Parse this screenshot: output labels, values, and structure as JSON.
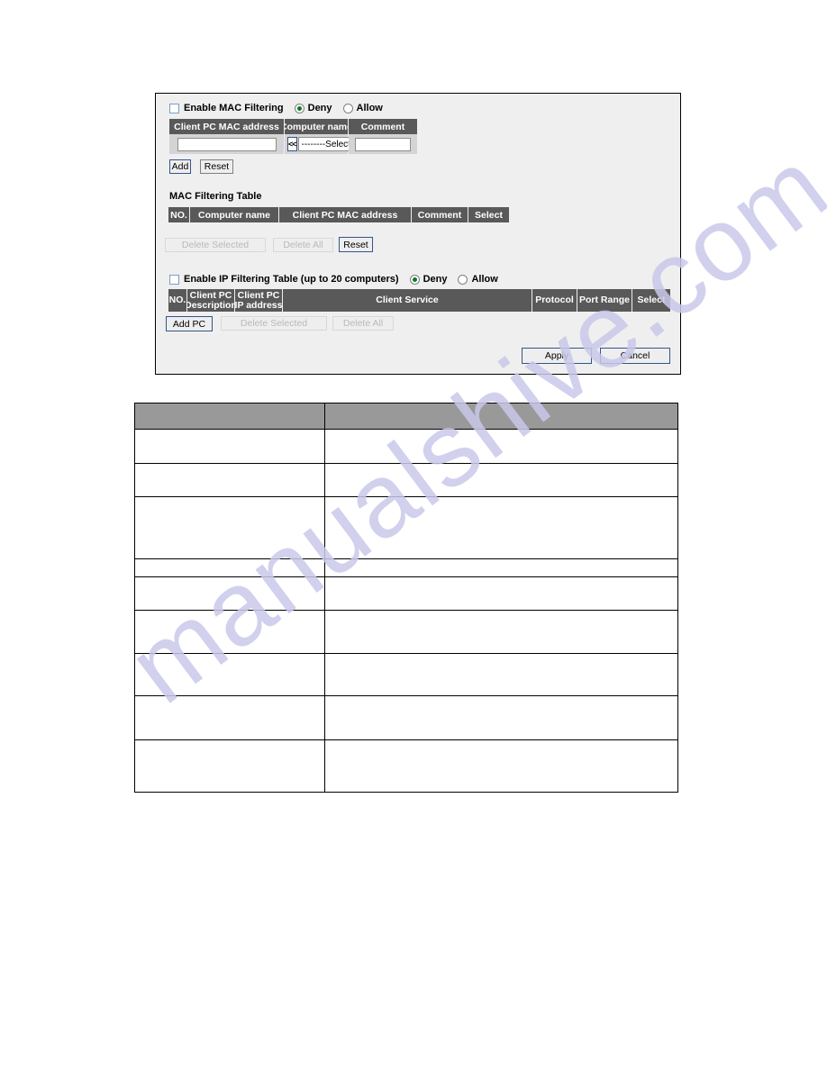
{
  "watermark": {
    "text": "manualshive.com"
  },
  "panel": {
    "mac_filtering": {
      "enable_label": "Enable MAC Filtering",
      "enable_checked": false,
      "deny_label": "Deny",
      "allow_label": "Allow",
      "mode_selected": "Deny",
      "columns": [
        "Client PC MAC address",
        "Computer name",
        "Comment"
      ],
      "mac_input_value": "",
      "select_value": "--------Select--------",
      "comment_input_value": "",
      "lt_button_label": "<<",
      "add_label": "Add",
      "reset_label": "Reset"
    },
    "mac_table": {
      "title": "MAC Filtering Table",
      "columns": [
        "NO.",
        "Computer name",
        "Client PC MAC address",
        "Comment",
        "Select"
      ],
      "rows": [],
      "delete_selected_label": "Delete Selected",
      "delete_all_label": "Delete All",
      "reset_label": "Reset"
    },
    "ip_filtering": {
      "enable_label": "Enable IP Filtering Table (up to 20 computers)",
      "enable_checked": false,
      "deny_label": "Deny",
      "allow_label": "Allow",
      "mode_selected": "Deny",
      "columns": [
        "NO.",
        "Client PC Description",
        "Client PC IP address",
        "Client Service",
        "Protocol",
        "Port Range",
        "Select"
      ],
      "col_no": "NO.",
      "col_desc_line1": "Client PC",
      "col_desc_line2": "Description",
      "col_ip_line1": "Client PC",
      "col_ip_line2": "IP address",
      "col_service": "Client Service",
      "col_protocol": "Protocol",
      "col_portrange": "Port Range",
      "col_select": "Select",
      "rows": [],
      "add_pc_label": "Add PC",
      "delete_selected_label": "Delete Selected",
      "delete_all_label": "Delete All"
    },
    "footer": {
      "apply_label": "Apply",
      "cancel_label": "Cancel"
    }
  },
  "desc_table": {
    "headers": [
      "",
      ""
    ],
    "rows": [
      {
        "label": "",
        "value": "",
        "height": 38
      },
      {
        "label": "",
        "value": "",
        "height": 37
      },
      {
        "label": "",
        "value": "",
        "height": 69
      },
      {
        "label": "",
        "value": "",
        "height": 20
      },
      {
        "label": "",
        "value": "",
        "height": 37
      },
      {
        "label": "",
        "value": "",
        "height": 48
      },
      {
        "label": "",
        "value": "",
        "height": 47
      },
      {
        "label": "",
        "value": "",
        "height": 49
      },
      {
        "label": "",
        "value": "",
        "height": 58
      }
    ]
  },
  "colors": {
    "panel_bg": "#efefef",
    "header_dark": "#595959",
    "header_light": "#999999",
    "field_bg": "#d4d4d4",
    "radio_dot": "#0c7a22",
    "watermark": "#c9c8ea"
  }
}
